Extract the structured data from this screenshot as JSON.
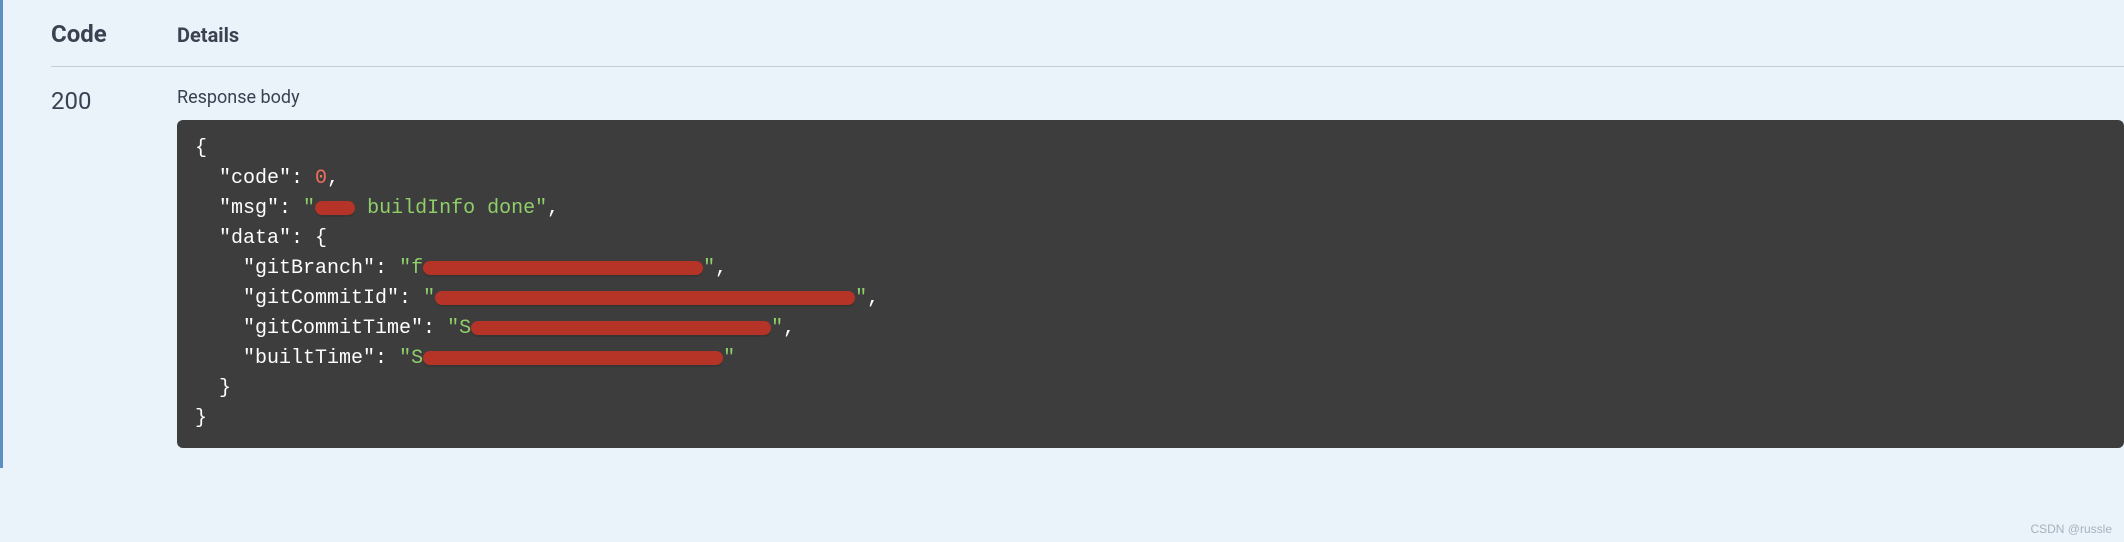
{
  "columns": {
    "code_header": "Code",
    "details_header": "Details"
  },
  "response": {
    "status_code": "200",
    "body_label": "Response body",
    "json": {
      "key_code": "\"code\"",
      "val_code": "0",
      "key_msg": "\"msg\"",
      "val_msg_visible_prefix": "\"",
      "val_msg_visible_suffix": " buildInfo done\"",
      "key_data": "\"data\"",
      "key_gitBranch": "\"gitBranch\"",
      "val_gitBranch_prefix": "\"f",
      "val_gitBranch_suffix": "\"",
      "key_gitCommitId": "\"gitCommitId\"",
      "val_gitCommitId_prefix": "\"",
      "val_gitCommitId_suffix": "\"",
      "key_gitCommitTime": "\"gitCommitTime\"",
      "val_gitCommitTime_prefix": "\"S",
      "val_gitCommitTime_suffix": "\"",
      "key_builtTime": "\"builtTime\"",
      "val_builtTime_prefix": "\"S",
      "val_builtTime_suffix": "\""
    }
  },
  "watermark": "CSDN @russle"
}
